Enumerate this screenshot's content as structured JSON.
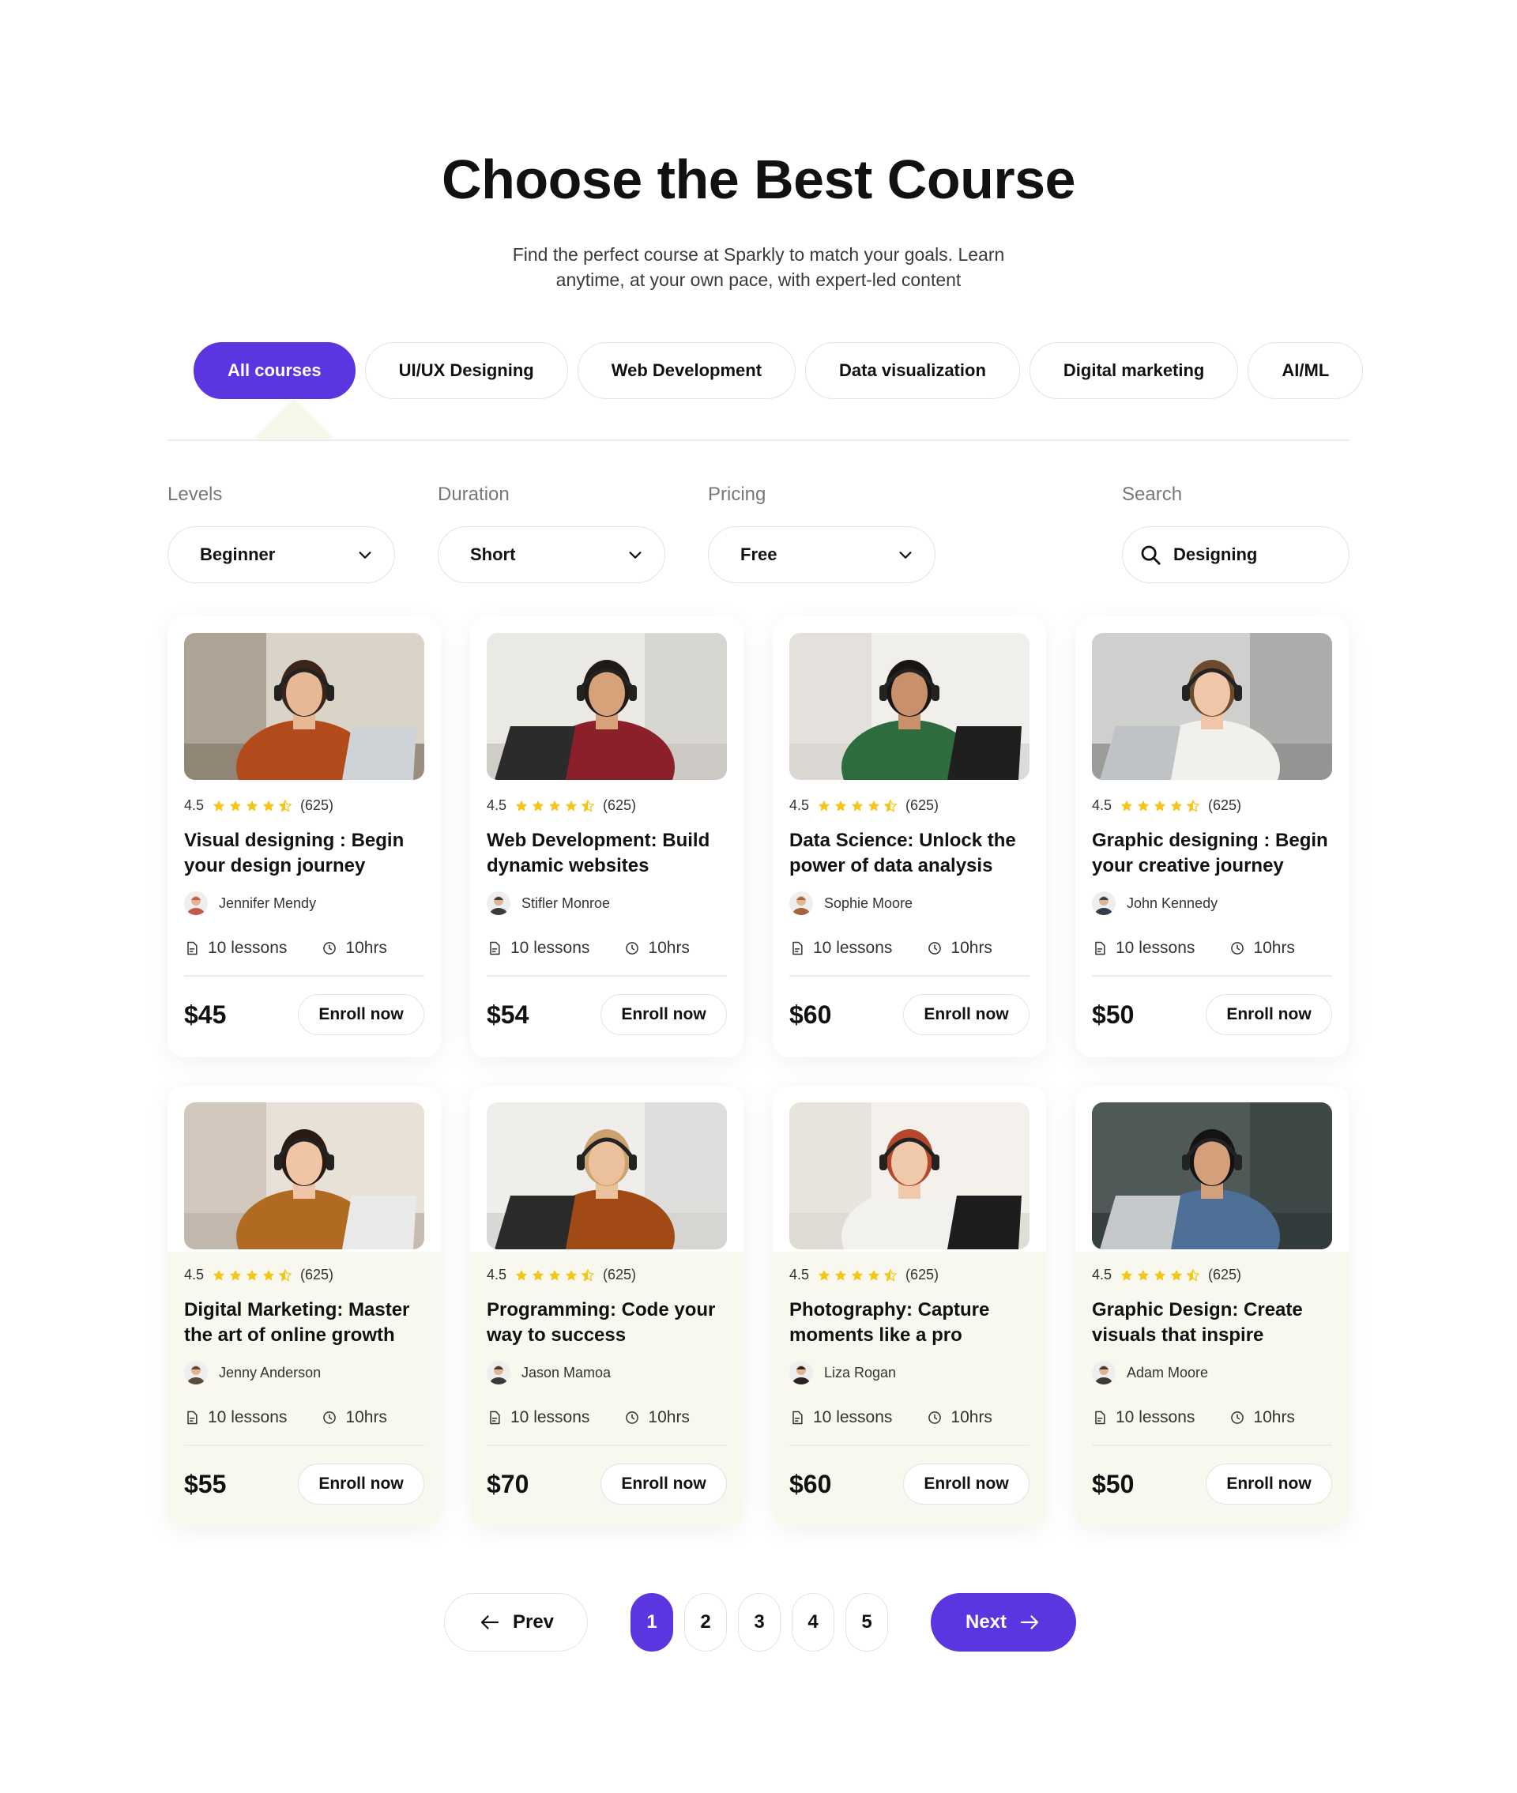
{
  "header": {
    "title": "Choose the Best Course",
    "subtitle": "Find the perfect course at Sparkly to match your goals. Learn anytime, at your own pace, with expert-led content"
  },
  "tabs": [
    {
      "label": "All courses",
      "active": true
    },
    {
      "label": "UI/UX Designing",
      "active": false
    },
    {
      "label": "Web Development",
      "active": false
    },
    {
      "label": "Data visualization",
      "active": false
    },
    {
      "label": "Digital marketing",
      "active": false
    },
    {
      "label": "AI/ML",
      "active": false
    }
  ],
  "filters": {
    "levels": {
      "label": "Levels",
      "value": "Beginner"
    },
    "duration": {
      "label": "Duration",
      "value": "Short"
    },
    "pricing": {
      "label": "Pricing",
      "value": "Free"
    },
    "search": {
      "label": "Search",
      "value": "Designing"
    }
  },
  "courses": [
    {
      "rating": "4.5",
      "stars": 4.5,
      "reviews": "(625)",
      "title": "Visual designing : Begin your design journey",
      "instructor": "Jennifer Mendy",
      "lessons": "10 lessons",
      "duration": "10hrs",
      "price": "$45",
      "cta": "Enroll now"
    },
    {
      "rating": "4.5",
      "stars": 4.5,
      "reviews": "(625)",
      "title": "Web Development: Build dynamic websites",
      "instructor": "Stifler Monroe",
      "lessons": "10 lessons",
      "duration": "10hrs",
      "price": "$54",
      "cta": "Enroll now"
    },
    {
      "rating": "4.5",
      "stars": 4.5,
      "reviews": "(625)",
      "title": "Data Science: Unlock the power of data analysis",
      "instructor": "Sophie Moore",
      "lessons": "10 lessons",
      "duration": "10hrs",
      "price": "$60",
      "cta": "Enroll now"
    },
    {
      "rating": "4.5",
      "stars": 4.5,
      "reviews": "(625)",
      "title": "Graphic designing : Begin your creative journey",
      "instructor": "John Kennedy",
      "lessons": "10 lessons",
      "duration": "10hrs",
      "price": "$50",
      "cta": "Enroll now"
    },
    {
      "rating": "4.5",
      "stars": 4.5,
      "reviews": "(625)",
      "title": "Digital Marketing: Master the art of online growth",
      "instructor": "Jenny Anderson",
      "lessons": "10 lessons",
      "duration": "10hrs",
      "price": "$55",
      "cta": "Enroll now"
    },
    {
      "rating": "4.5",
      "stars": 4.5,
      "reviews": "(625)",
      "title": "Programming: Code your way to success",
      "instructor": "Jason Mamoa",
      "lessons": "10 lessons",
      "duration": "10hrs",
      "price": "$70",
      "cta": "Enroll now"
    },
    {
      "rating": "4.5",
      "stars": 4.5,
      "reviews": "(625)",
      "title": "Photography: Capture moments like a pro",
      "instructor": "Liza Rogan",
      "lessons": "10 lessons",
      "duration": "10hrs",
      "price": "$60",
      "cta": "Enroll now"
    },
    {
      "rating": "4.5",
      "stars": 4.5,
      "reviews": "(625)",
      "title": "Graphic Design: Create visuals that inspire",
      "instructor": "Adam Moore",
      "lessons": "10 lessons",
      "duration": "10hrs",
      "price": "$50",
      "cta": "Enroll now"
    }
  ],
  "pagination": {
    "prev": "Prev",
    "next": "Next",
    "pages": [
      "1",
      "2",
      "3",
      "4",
      "5"
    ],
    "current": "1"
  },
  "colors": {
    "accent": "#5a35e0",
    "star": "#f5c518",
    "card_tint": "#f8f8ee"
  }
}
